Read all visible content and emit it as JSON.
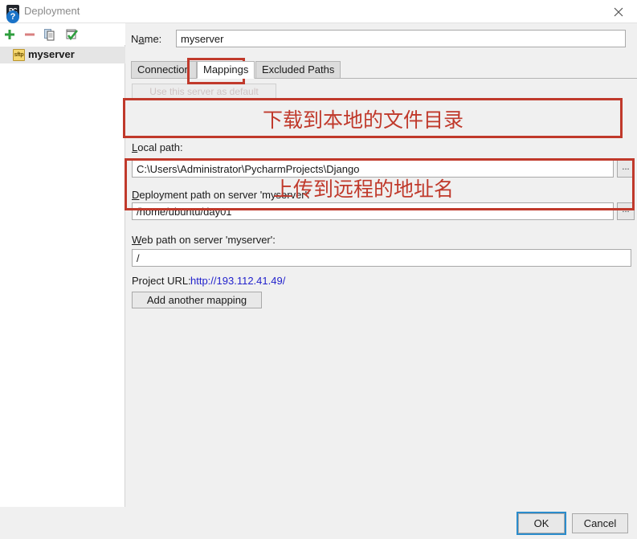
{
  "window": {
    "title": "Deployment",
    "app_icon": "pycharm-icon",
    "close_icon": "close-icon"
  },
  "left_panel": {
    "toolbar": [
      {
        "name": "add-server-button",
        "icon": "plus-icon",
        "tooltip": "Add"
      },
      {
        "name": "remove-server-button",
        "icon": "minus-icon",
        "tooltip": "Remove"
      },
      {
        "name": "copy-server-button",
        "icon": "copy-icon",
        "tooltip": "Copy"
      },
      {
        "name": "set-default-server-button",
        "icon": "check-list-icon",
        "tooltip": "Use as Default"
      }
    ],
    "servers": [
      {
        "label": "myserver",
        "icon_label": "sftp",
        "selected": true
      }
    ]
  },
  "form": {
    "name_label": "Name:",
    "name_value": "myserver",
    "name_placeholder": ""
  },
  "tabs": [
    {
      "label": "Connection",
      "active": false
    },
    {
      "label": "Mappings",
      "active": true
    },
    {
      "label": "Excluded Paths",
      "active": false
    }
  ],
  "mappings": {
    "default_button_label": "Use this server as default",
    "local_path_label": "Local path:",
    "local_path_value": "C:\\Users\\Administrator\\PycharmProjects\\Django",
    "local_browse_label": "...",
    "deployment_path_label": "Deployment path on server 'myserver':",
    "deployment_path_value": "/home/ubuntu/day01",
    "deployment_browse_label": "...",
    "web_path_label": "Web path on server 'myserver':",
    "web_path_value": "/",
    "project_url_label": "Project URL:",
    "project_url_value": "http://193.112.41.49/",
    "add_mapping_label": "Add another mapping"
  },
  "annotations": [
    {
      "text": "下载到本地的文件目录",
      "color": "#c0392b"
    },
    {
      "text": "上传到远程的地址名",
      "color": "#c0392b"
    }
  ],
  "footer": {
    "help_icon": "help-icon",
    "help_label": "?",
    "ok_label": "OK",
    "cancel_label": "Cancel"
  },
  "colors": {
    "annotation_red": "#c0392b",
    "link_blue": "#2222cc",
    "focus_blue": "#2b8ccc",
    "selection_gray": "#e5e5e5"
  }
}
